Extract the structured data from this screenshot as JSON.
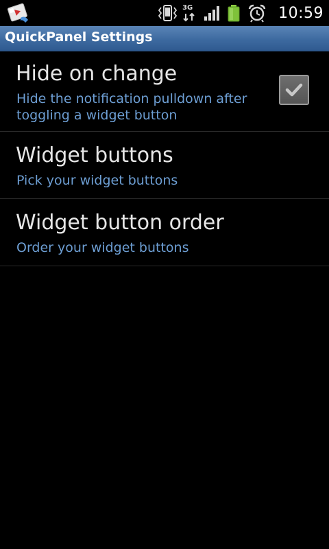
{
  "status_bar": {
    "time": "10:59",
    "network_label": "3G",
    "icons": [
      "notification-app-icon",
      "vibrate-icon",
      "data-3g-icon",
      "signal-icon",
      "battery-icon",
      "alarm-icon"
    ],
    "battery_color": "#7fc23a"
  },
  "title_bar": {
    "title": "QuickPanel Settings",
    "color": "#3d6aa0"
  },
  "preferences": [
    {
      "title": "Hide on change",
      "summary": "Hide the notification pulldown after toggling a widget button",
      "checked": true
    },
    {
      "title": "Widget buttons",
      "summary": "Pick your widget buttons"
    },
    {
      "title": "Widget button order",
      "summary": "Order your widget buttons"
    }
  ]
}
